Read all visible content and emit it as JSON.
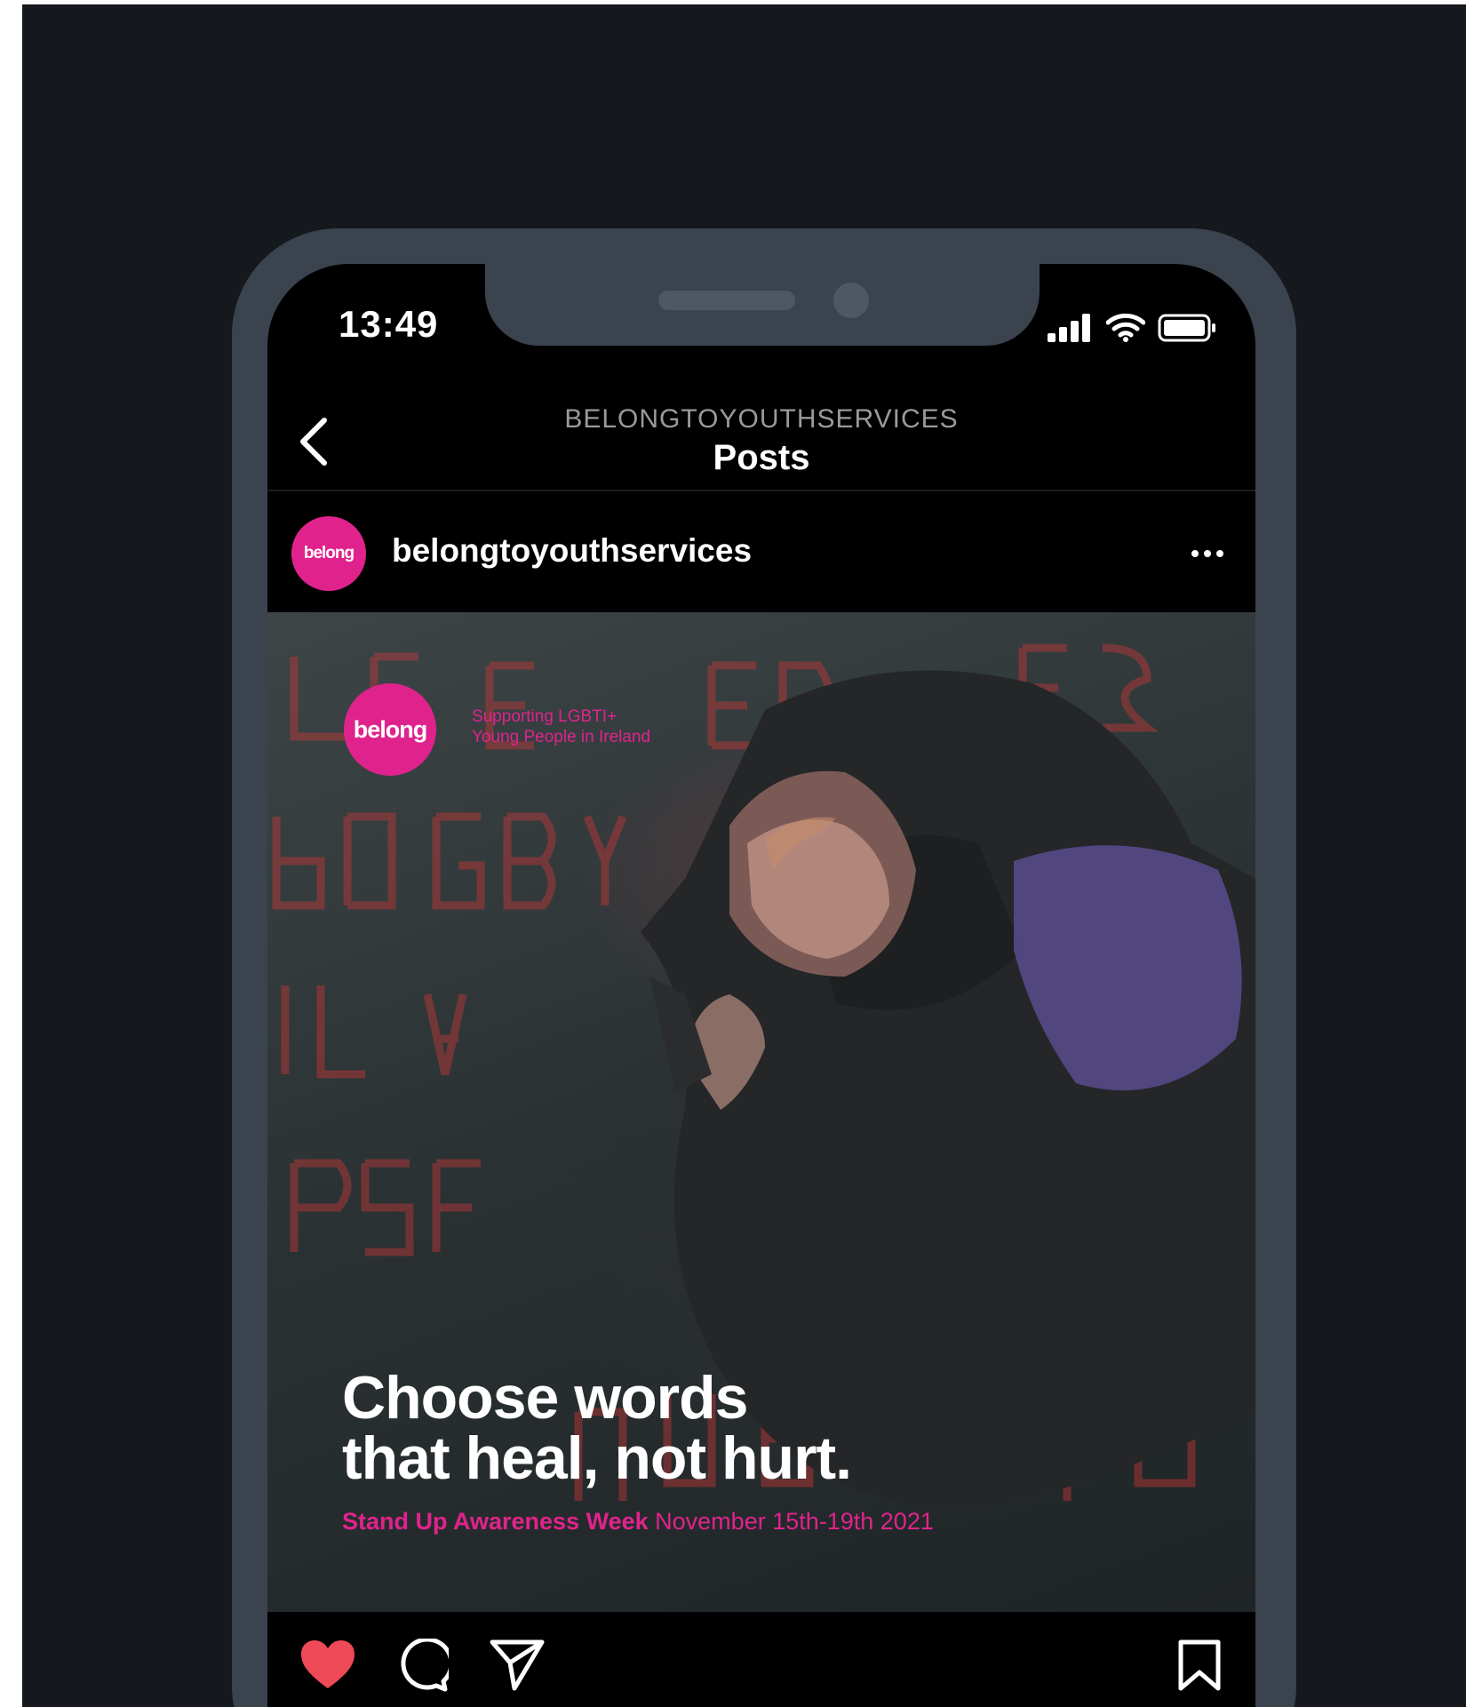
{
  "status_bar": {
    "time": "13:49"
  },
  "nav": {
    "username": "BELONGTOYOUTHSERVICES",
    "title": "Posts"
  },
  "post": {
    "avatar_text": "belong",
    "username": "belongtoyouthservices",
    "image": {
      "logo_text": "belong",
      "tagline_line1": "Supporting LGBTI+",
      "tagline_line2": "Young People in Ireland",
      "headline_line1": "Choose words",
      "headline_line2": "that heal, not hurt.",
      "campaign_name": "Stand Up Awareness Week",
      "campaign_dates": "November 15th-19th 2021"
    }
  },
  "icons": {
    "back": "chevron-left-icon",
    "more": "more-horizontal-icon",
    "like": "heart-filled-icon",
    "comment": "comment-icon",
    "share": "send-icon",
    "save": "bookmark-icon",
    "signal": "signal-icon",
    "wifi": "wifi-icon",
    "battery": "battery-icon"
  },
  "colors": {
    "brand_pink": "#e0238c",
    "like_red": "#ee4956",
    "phone_frame": "#3b434f",
    "background": "#15181d"
  }
}
